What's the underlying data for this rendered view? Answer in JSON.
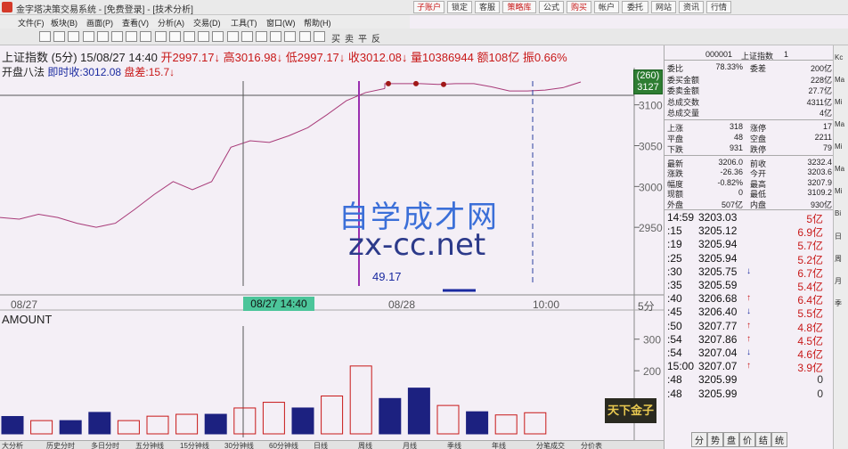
{
  "window": {
    "title": "金字塔决策交易系统 - [免费登录] - [技术分析]",
    "top_buttons": [
      {
        "label": "子账户",
        "red": true
      },
      {
        "label": "锁定",
        "red": false
      },
      {
        "label": "客服",
        "red": false
      },
      {
        "label": "策略库",
        "red": true
      },
      {
        "label": "公式",
        "red": false
      },
      {
        "label": "购买",
        "red": true
      },
      {
        "label": "帐户",
        "red": false
      },
      {
        "label": "委托",
        "red": false
      },
      {
        "label": "网站",
        "red": false
      },
      {
        "label": "资讯",
        "red": false
      },
      {
        "label": "行情",
        "red": false
      }
    ]
  },
  "menu": [
    "文件(F)",
    "板块(B)",
    "画面(P)",
    "查看(V)",
    "分析(A)",
    "交易(D)",
    "工具(T)",
    "窗口(W)",
    "帮助(H)"
  ],
  "toolbar": {
    "text_tools": [
      "买",
      "卖",
      "平",
      "反"
    ]
  },
  "chart_header": {
    "name": "上证指数",
    "period": "(5分)",
    "datetime": "15/08/27 14:40",
    "open_label": "开2997.17",
    "high_label": "高3016.98",
    "low_label": "低2997.17",
    "close_label": "收3012.08",
    "volume_label": "量10386944",
    "amount_label": "额108亿",
    "amplitude_label": "振0.66%",
    "line2_a": "开盘八法",
    "line2_b": "即时收:3012.08",
    "line2_c": "盘差:15.7"
  },
  "price_box": {
    "line1": "(260)",
    "line2": "3127"
  },
  "watermark": {
    "cn": "自学成才网",
    "en": "zx-cc.net"
  },
  "annotation_value": "49.17",
  "time_cursor_label": "08/27 14:40",
  "x_labels": {
    "a": "08/27",
    "b": "08/28",
    "c": "10:00",
    "period": "5分"
  },
  "amount_title": "AMOUNT",
  "chart_data": [
    {
      "type": "line",
      "title": "上证指数 (5分)",
      "ylim": [
        2900,
        3140
      ],
      "yticks": [
        2950,
        3000,
        3050,
        3100
      ],
      "x": [
        0,
        1,
        2,
        3,
        4,
        5,
        6,
        7,
        8,
        9,
        10,
        11,
        12,
        13,
        14,
        15,
        16,
        17,
        18,
        19,
        20
      ],
      "values": [
        2962,
        2960,
        2966,
        2962,
        2955,
        2950,
        2955,
        2972,
        2990,
        3006,
        2996,
        3006,
        3048,
        3056,
        3054,
        3062,
        3072,
        3088,
        3105,
        3115,
        3120
      ],
      "values_day2": [
        3126,
        3126,
        3126,
        3125,
        3126,
        3126,
        3122,
        3117,
        3117,
        3118,
        3121,
        3128
      ]
    },
    {
      "type": "bar",
      "title": "AMOUNT",
      "ylim": [
        0,
        350
      ],
      "yticks": [
        200,
        300
      ],
      "values": [
        55,
        42,
        42,
        68,
        42,
        56,
        62,
        62,
        82,
        100,
        82,
        120,
        215,
        112,
        145,
        90,
        70,
        60,
        67
      ]
    }
  ],
  "quote_panel": {
    "code": "000001",
    "name": "上证指数",
    "seq": "1",
    "rows_a": [
      {
        "l": "委比",
        "v": "78.33%",
        "l2": "委差",
        "v2": "200亿"
      },
      {
        "l": "委买金额",
        "v": "",
        "l2": "",
        "v2": "228亿"
      },
      {
        "l": "委卖金额",
        "v": "",
        "l2": "",
        "v2": "27.7亿"
      },
      {
        "l": "总成交数",
        "v": "",
        "l2": "",
        "v2": "4311亿"
      },
      {
        "l": "总成交量",
        "v": "",
        "l2": "",
        "v2": "4亿"
      }
    ],
    "rows_b": [
      {
        "l": "上涨",
        "v": "318",
        "l2": "涨停",
        "v2": "17"
      },
      {
        "l": "平盘",
        "v": "48",
        "l2": "空盘",
        "v2": "2211"
      },
      {
        "l": "下跌",
        "v": "931",
        "l2": "跌停",
        "v2": "79"
      }
    ],
    "rows_c": [
      {
        "l": "最新",
        "v": "3206.0",
        "l2": "前收",
        "v2": "3232.4"
      },
      {
        "l": "涨跌",
        "v": "-26.36",
        "l2": "今开",
        "v2": "3203.6"
      },
      {
        "l": "幅度",
        "v": "-0.82%",
        "l2": "最高",
        "v2": "3207.9"
      },
      {
        "l": "现额",
        "v": "0",
        "l2": "最低",
        "v2": "3109.2"
      },
      {
        "l": "外盘",
        "v": "507亿",
        "l2": "内盘",
        "v2": "930亿"
      }
    ],
    "ticks": [
      {
        "t": "14:59",
        "p": "3203.03",
        "a": "",
        "v": "5亿"
      },
      {
        "t": ":15",
        "p": "3205.12",
        "a": "",
        "v": "6.9亿"
      },
      {
        "t": ":19",
        "p": "3205.94",
        "a": "",
        "v": "5.7亿"
      },
      {
        "t": ":25",
        "p": "3205.94",
        "a": "",
        "v": "5.2亿"
      },
      {
        "t": ":30",
        "p": "3205.75",
        "a": "↓",
        "v": "6.7亿"
      },
      {
        "t": ":35",
        "p": "3205.59",
        "a": "",
        "v": "5.4亿"
      },
      {
        "t": ":40",
        "p": "3206.68",
        "a": "↑",
        "v": "6.4亿"
      },
      {
        "t": ":45",
        "p": "3206.40",
        "a": "↓",
        "v": "5.5亿"
      },
      {
        "t": ":50",
        "p": "3207.77",
        "a": "↑",
        "v": "4.8亿"
      },
      {
        "t": ":54",
        "p": "3207.86",
        "a": "↑",
        "v": "4.5亿"
      },
      {
        "t": ":54",
        "p": "3207.04",
        "a": "↓",
        "v": "4.6亿"
      },
      {
        "t": "15:00",
        "p": "3207.07",
        "a": "↑",
        "v": "3.9亿"
      },
      {
        "t": ":48",
        "p": "3205.99",
        "a": "",
        "v": "0"
      },
      {
        "t": ":48",
        "p": "3205.99",
        "a": "",
        "v": "0"
      }
    ],
    "bottom_tabs": [
      "分",
      "势",
      "盘",
      "价",
      "结",
      "统"
    ]
  },
  "far_right_labels": [
    "Kc",
    "Ma",
    "Mi",
    "Ma",
    "Mi",
    "Ma",
    "Mi",
    "Bi",
    "日",
    "周",
    "月",
    "季"
  ],
  "bottom_tabs": [
    "大分析",
    "历史分时",
    "多日分时",
    "五分钟线",
    "15分钟线",
    "30分钟线",
    "60分钟线",
    "日线",
    "周线",
    "月线",
    "季线",
    "年线",
    "分笔成交",
    "分价表"
  ],
  "logo_stamp": "天下金子",
  "colors": {
    "up": "#c81818",
    "down": "#1a2aa0",
    "bar_down": "#1c2180",
    "line": "#a83a78",
    "cursor": "#9b2fb0"
  }
}
